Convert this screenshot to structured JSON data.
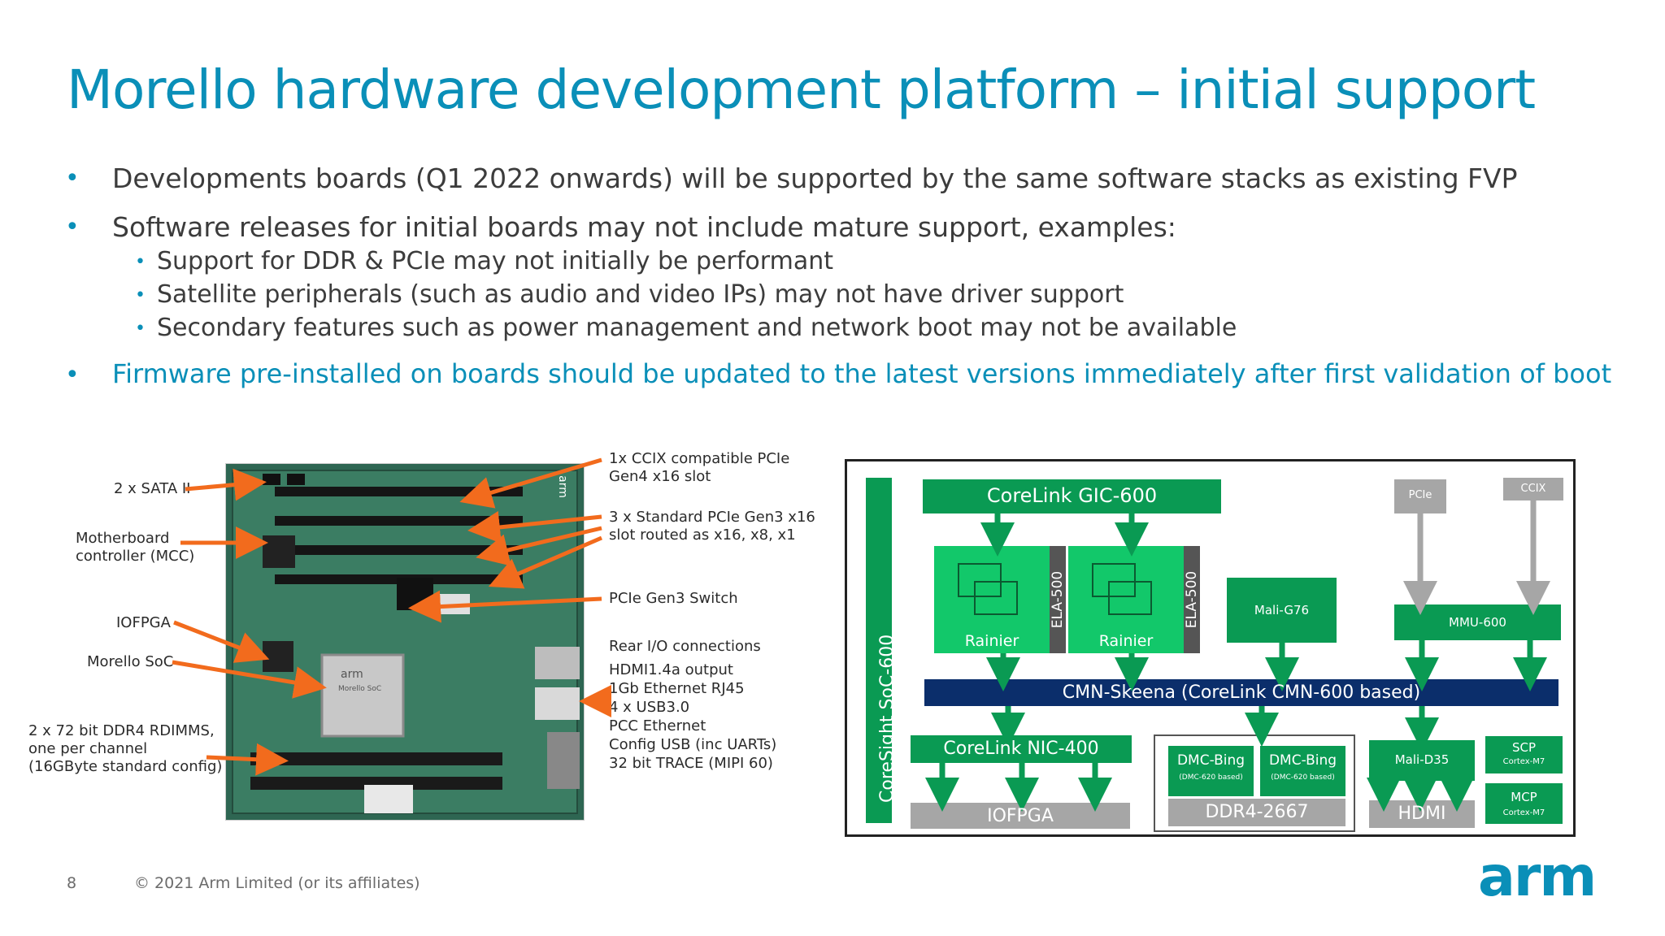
{
  "slide": {
    "title": "Morello hardware development platform – initial support",
    "bullets": [
      "Developments boards (Q1 2022 onwards) will be supported by the same software stacks as existing FVP",
      "Software releases for initial boards may not include mature support, examples:"
    ],
    "sub_bullets": [
      "Support for DDR & PCIe may not initially be performant",
      "Satellite peripherals (such as audio and video IPs) may not have driver support",
      "Secondary features such as power management and network boot may not be available"
    ],
    "highlight_bullet": "Firmware pre-installed on boards should be updated to the latest versions immediately after first validation of boot",
    "page_number": "8",
    "copyright": "© 2021 Arm Limited (or its affiliates)",
    "logo_text": "arm"
  },
  "board_photo": {
    "chip_label": "arm",
    "chip_sub": "Morello SoC",
    "side_text": "arm",
    "left_labels": {
      "sata": "2 x SATA II",
      "mcc_1": "Motherboard",
      "mcc_2": "controller (MCC)",
      "iofpga": "IOFPGA",
      "soc": "Morello SoC",
      "ddr_1": "2 x 72 bit DDR4 RDIMMS,",
      "ddr_2": "one per channel",
      "ddr_3": "(16GByte standard config)"
    },
    "right_labels": {
      "ccix_1": "1x CCIX compatible PCIe",
      "ccix_2": "Gen4 x16 slot",
      "pcie_1": "3 x Standard PCIe Gen3 x16",
      "pcie_2": "slot routed as x16, x8, x1",
      "switch": "PCIe Gen3 Switch",
      "rear_title": "Rear I/O connections",
      "rear_items": [
        "HDMI1.4a output",
        "1Gb Ethernet RJ45",
        "4 x USB3.0",
        "PCC Ethernet",
        "Config USB (inc UARTs)",
        "32 bit TRACE (MIPI 60)"
      ]
    }
  },
  "block_diagram": {
    "coresight": "CoreSight SoC-600",
    "gic": "CoreLink GIC-600",
    "pcie": "PCIe",
    "ccix": "CCIX",
    "rainier": "Rainier",
    "ela": "ELA-500",
    "mali_g76": "Mali-G76",
    "mmu": "MMU-600",
    "cmn": "CMN-Skeena (CoreLink CMN-600 based)",
    "nic": "CoreLink NIC-400",
    "iofpga": "IOFPGA",
    "dmc": "DMC-Bing",
    "dmc_sub": "(DMC-620 based)",
    "ddr": "DDR4-2667",
    "mali_d35": "Mali-D35",
    "hdmi": "HDMI",
    "scp": "SCP",
    "mcp": "MCP",
    "cortex": "Cortex-M7"
  },
  "colors": {
    "accent": "#0a8fb8",
    "green": "#0a9a53",
    "bright_green": "#12c86a",
    "navy": "#0b2e6b",
    "gray": "#a6a6a6",
    "arrow_orange": "#f26b1d"
  }
}
